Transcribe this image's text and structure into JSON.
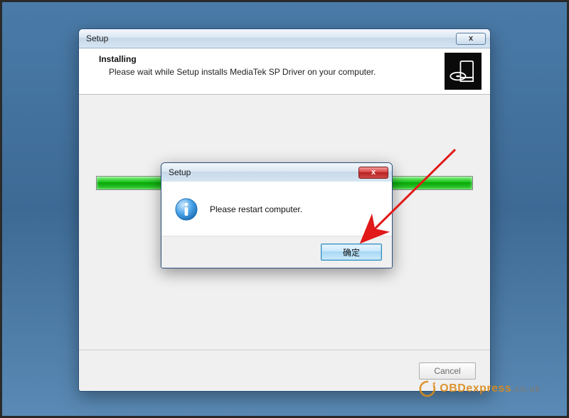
{
  "wizard": {
    "title": "Setup",
    "close_glyph": "x",
    "header_title": "Installing",
    "header_subtitle": "Please wait while Setup installs MediaTek SP Driver on your computer.",
    "progress_percent": 100,
    "cancel_label": "Cancel"
  },
  "msgbox": {
    "title": "Setup",
    "close_glyph": "x",
    "message": "Please restart computer.",
    "ok_label": "确定"
  },
  "watermark": {
    "brand_main": "OBDexpress",
    "brand_suffix": ".co.uk"
  },
  "colors": {
    "progress_green": "#17c217",
    "accent_blue": "#2a8fbf",
    "close_red": "#c53030",
    "annotation_red": "#e11919"
  }
}
